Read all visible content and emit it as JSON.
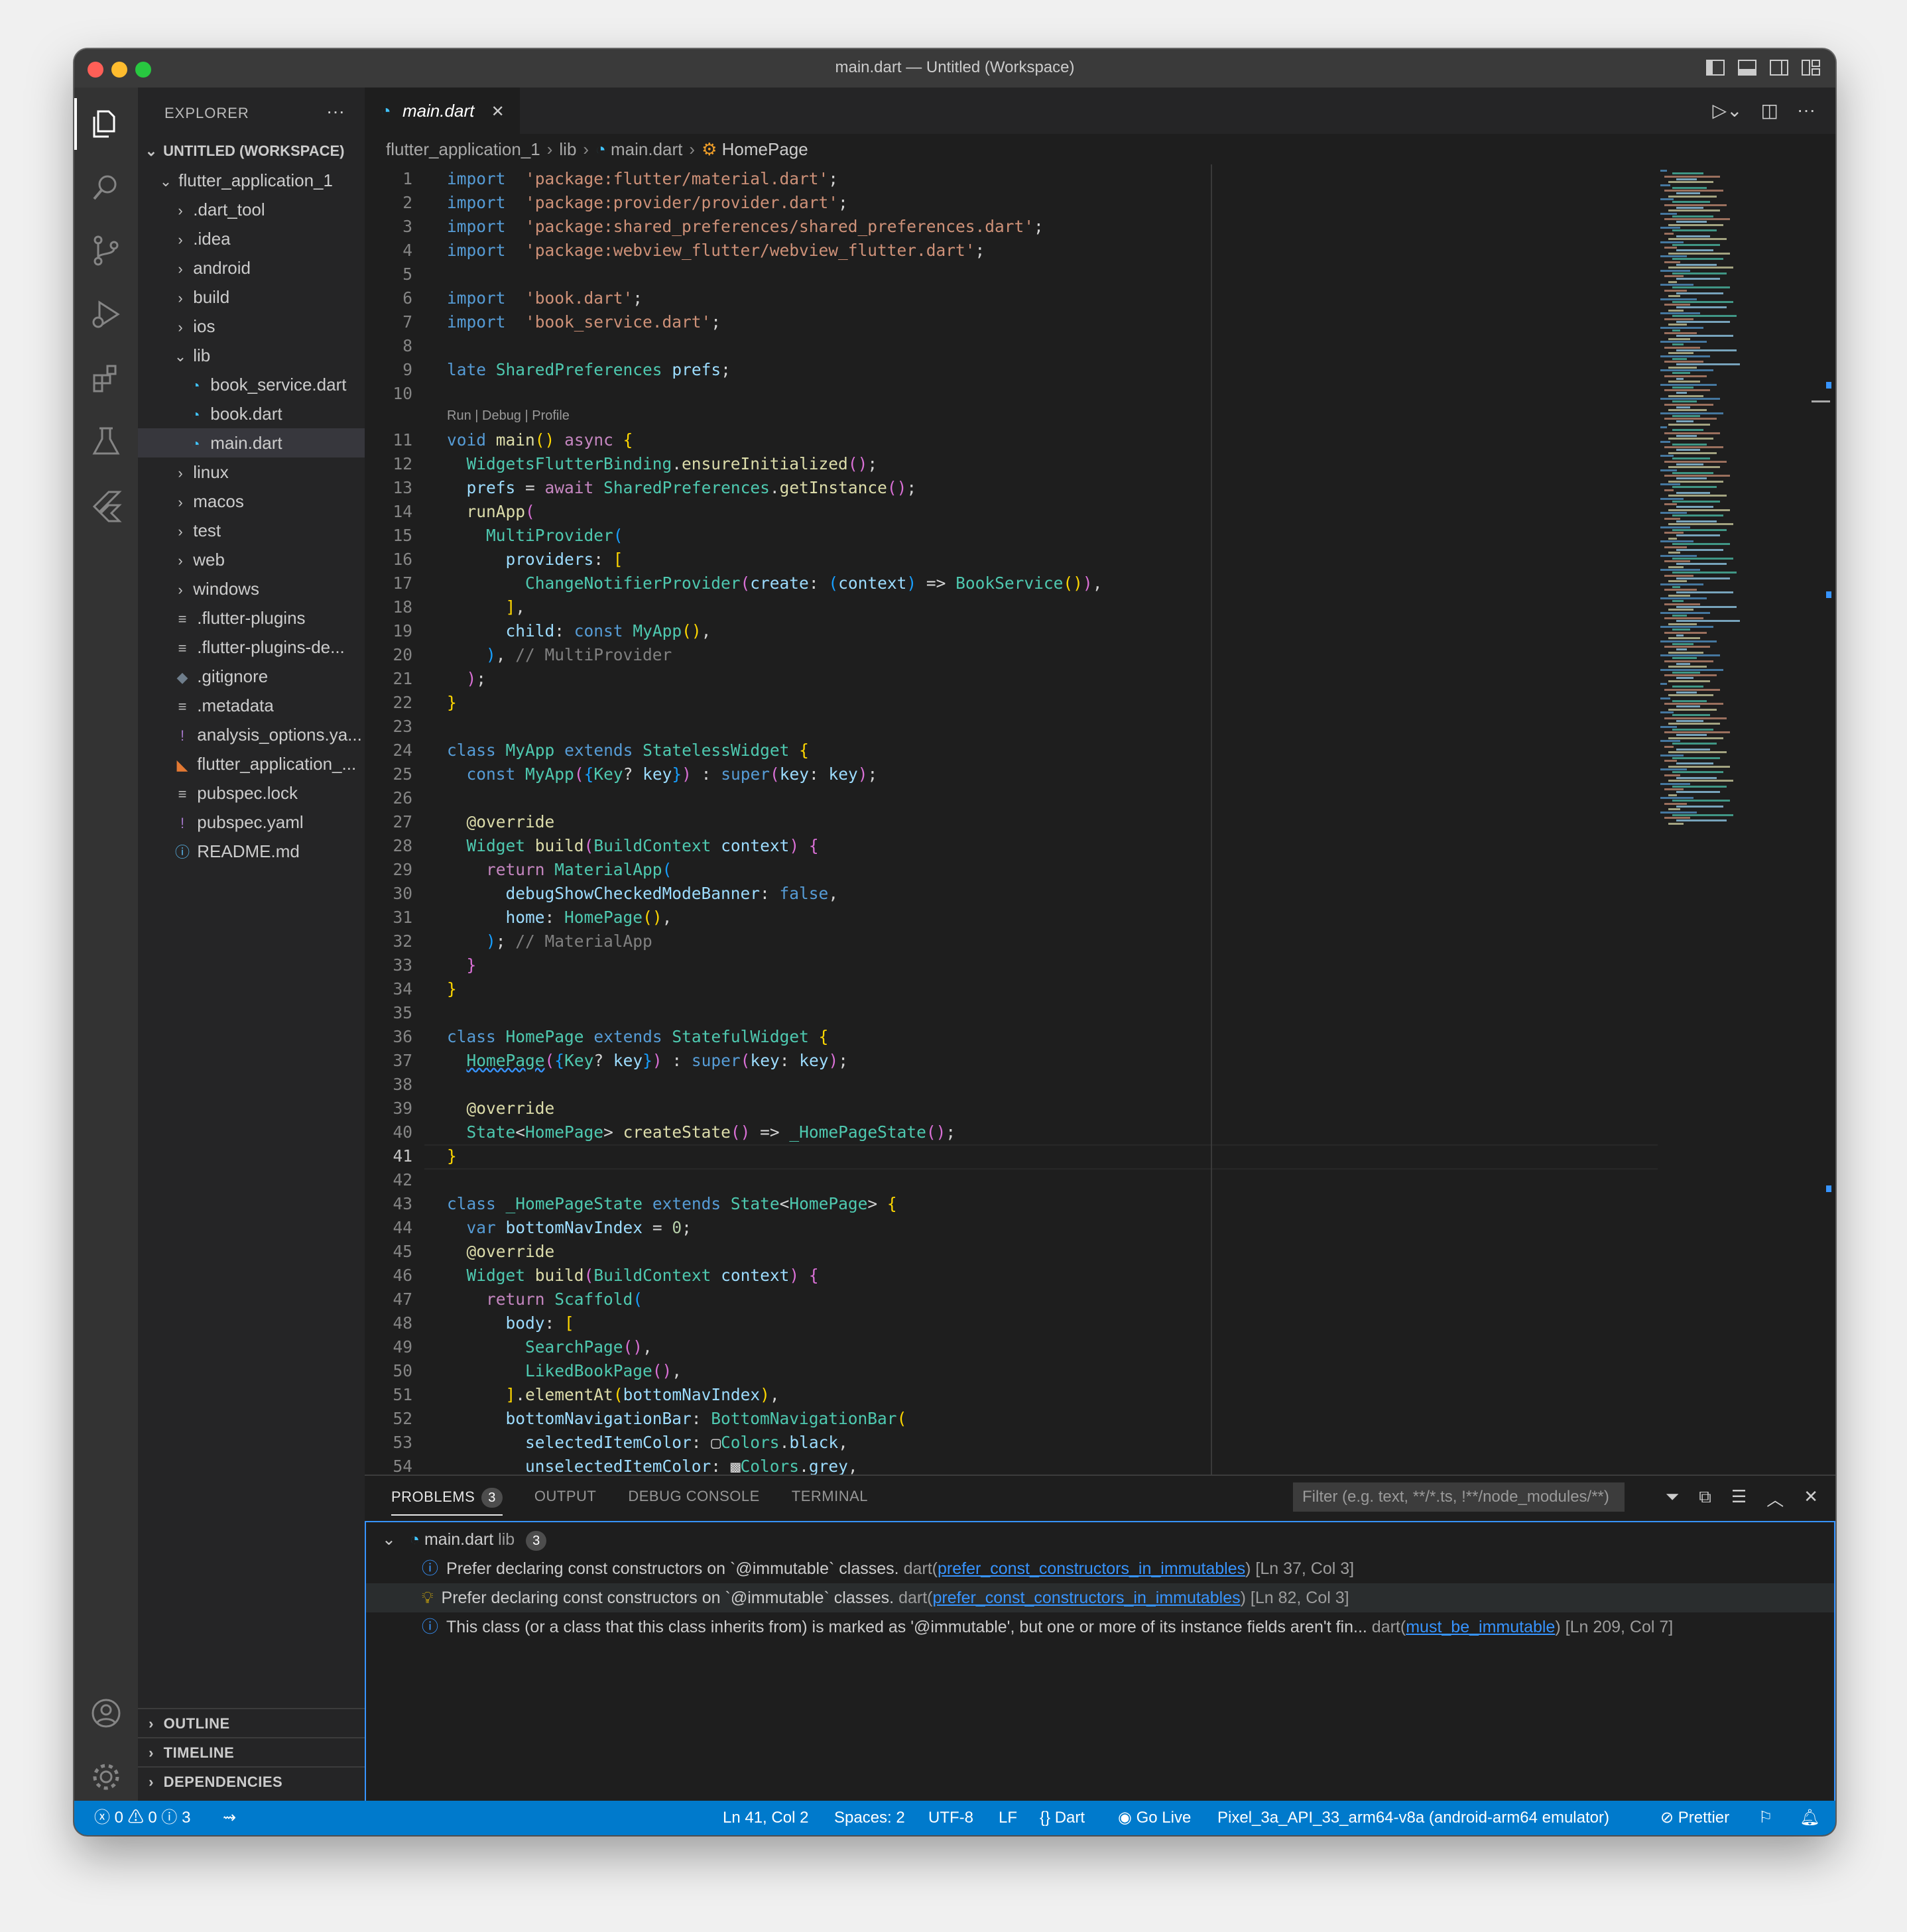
{
  "window": {
    "title": "main.dart — Untitled (Workspace)"
  },
  "explorer": {
    "header": "EXPLORER",
    "more": "···",
    "workspace": "UNTITLED (WORKSPACE)",
    "project": "flutter_application_1",
    "items": [
      {
        "label": ".dart_tool",
        "kind": "folder",
        "indent": 1
      },
      {
        "label": ".idea",
        "kind": "folder",
        "indent": 1
      },
      {
        "label": "android",
        "kind": "folder",
        "indent": 1
      },
      {
        "label": "build",
        "kind": "folder",
        "indent": 1
      },
      {
        "label": "ios",
        "kind": "folder",
        "indent": 1
      },
      {
        "label": "lib",
        "kind": "folder-open",
        "indent": 1
      },
      {
        "label": "book_service.dart",
        "kind": "dart",
        "indent": 2
      },
      {
        "label": "book.dart",
        "kind": "dart",
        "indent": 2
      },
      {
        "label": "main.dart",
        "kind": "dart",
        "indent": 2,
        "selected": true
      },
      {
        "label": "linux",
        "kind": "folder",
        "indent": 1
      },
      {
        "label": "macos",
        "kind": "folder",
        "indent": 1
      },
      {
        "label": "test",
        "kind": "folder",
        "indent": 1
      },
      {
        "label": "web",
        "kind": "folder",
        "indent": 1
      },
      {
        "label": "windows",
        "kind": "folder",
        "indent": 1
      },
      {
        "label": ".flutter-plugins",
        "kind": "lines",
        "indent": 1
      },
      {
        "label": ".flutter-plugins-de...",
        "kind": "lines",
        "indent": 1
      },
      {
        "label": ".gitignore",
        "kind": "git",
        "indent": 1
      },
      {
        "label": ".metadata",
        "kind": "lines",
        "indent": 1
      },
      {
        "label": "analysis_options.ya...",
        "kind": "yaml",
        "indent": 1
      },
      {
        "label": "flutter_application_...",
        "kind": "rss",
        "indent": 1
      },
      {
        "label": "pubspec.lock",
        "kind": "lines",
        "indent": 1
      },
      {
        "label": "pubspec.yaml",
        "kind": "yaml",
        "indent": 1
      },
      {
        "label": "README.md",
        "kind": "info",
        "indent": 1
      }
    ],
    "sections": [
      "OUTLINE",
      "TIMELINE",
      "DEPENDENCIES"
    ]
  },
  "tab": {
    "label": "main.dart",
    "close": "✕"
  },
  "breadcrumb": [
    "flutter_application_1",
    "lib",
    "main.dart",
    "HomePage"
  ],
  "codelens": "Run | Debug | Profile",
  "code": [
    [
      [
        "kw",
        "import"
      ],
      [
        "",
        "  "
      ],
      [
        "st",
        "'package:flutter/material.dart'"
      ],
      [
        "",
        ";"
      ]
    ],
    [
      [
        "kw",
        "import"
      ],
      [
        "",
        "  "
      ],
      [
        "st",
        "'package:provider/provider.dart'"
      ],
      [
        "",
        ";"
      ]
    ],
    [
      [
        "kw",
        "import"
      ],
      [
        "",
        "  "
      ],
      [
        "st",
        "'package:shared_preferences/shared_preferences.dart'"
      ],
      [
        "",
        ";"
      ]
    ],
    [
      [
        "kw",
        "import"
      ],
      [
        "",
        "  "
      ],
      [
        "st",
        "'package:webview_flutter/webview_flutter.dart'"
      ],
      [
        "",
        ";"
      ]
    ],
    [],
    [
      [
        "kw",
        "import"
      ],
      [
        "",
        "  "
      ],
      [
        "st",
        "'book.dart'"
      ],
      [
        "",
        ";"
      ]
    ],
    [
      [
        "kw",
        "import"
      ],
      [
        "",
        "  "
      ],
      [
        "st",
        "'book_service.dart'"
      ],
      [
        "",
        ";"
      ]
    ],
    [],
    [
      [
        "kw",
        "late"
      ],
      [
        "",
        " "
      ],
      [
        "ty",
        "SharedPreferences"
      ],
      [
        "",
        " "
      ],
      [
        "va",
        "prefs"
      ],
      [
        "",
        ";"
      ]
    ],
    [],
    [
      [
        "kw",
        "void"
      ],
      [
        "",
        " "
      ],
      [
        "fn",
        "main"
      ],
      [
        "br",
        "()"
      ],
      [
        "",
        " "
      ],
      [
        "kw2",
        "async"
      ],
      [
        "",
        " "
      ],
      [
        "br",
        "{"
      ]
    ],
    [
      [
        "",
        "  "
      ],
      [
        "ty",
        "WidgetsFlutterBinding"
      ],
      [
        "",
        "."
      ],
      [
        "fn",
        "ensureInitialized"
      ],
      [
        "br2",
        "()"
      ],
      [
        "",
        ";"
      ]
    ],
    [
      [
        "",
        "  "
      ],
      [
        "va",
        "prefs"
      ],
      [
        "",
        " = "
      ],
      [
        "kw2",
        "await"
      ],
      [
        "",
        " "
      ],
      [
        "ty",
        "SharedPreferences"
      ],
      [
        "",
        "."
      ],
      [
        "fn",
        "getInstance"
      ],
      [
        "br2",
        "()"
      ],
      [
        "",
        ";"
      ]
    ],
    [
      [
        "",
        "  "
      ],
      [
        "fn",
        "runApp"
      ],
      [
        "br2",
        "("
      ]
    ],
    [
      [
        "",
        "    "
      ],
      [
        "ty",
        "MultiProvider"
      ],
      [
        "br3",
        "("
      ]
    ],
    [
      [
        "",
        "      "
      ],
      [
        "va",
        "providers"
      ],
      [
        "",
        ": "
      ],
      [
        "br",
        "["
      ]
    ],
    [
      [
        "",
        "        "
      ],
      [
        "ty",
        "ChangeNotifierProvider"
      ],
      [
        "br2",
        "("
      ],
      [
        "va",
        "create"
      ],
      [
        "",
        ": "
      ],
      [
        "br3",
        "("
      ],
      [
        "va",
        "context"
      ],
      [
        "br3",
        ")"
      ],
      [
        "",
        " => "
      ],
      [
        "ty",
        "BookService"
      ],
      [
        "br",
        "()"
      ],
      [
        "br2",
        ")"
      ],
      [
        "",
        ","
      ]
    ],
    [
      [
        "",
        "      "
      ],
      [
        "br",
        "]"
      ],
      [
        "",
        ","
      ]
    ],
    [
      [
        "",
        "      "
      ],
      [
        "va",
        "child"
      ],
      [
        "",
        ": "
      ],
      [
        "kw",
        "const"
      ],
      [
        "",
        " "
      ],
      [
        "ty",
        "MyApp"
      ],
      [
        "br",
        "()"
      ],
      [
        "",
        ","
      ]
    ],
    [
      [
        "",
        "    "
      ],
      [
        "br3",
        ")"
      ],
      [
        "",
        ", "
      ],
      [
        "gr",
        "// MultiProvider"
      ]
    ],
    [
      [
        "",
        "  "
      ],
      [
        "br2",
        ")"
      ],
      [
        "",
        ";"
      ]
    ],
    [
      [
        "br",
        "}"
      ]
    ],
    [],
    [
      [
        "kw",
        "class"
      ],
      [
        "",
        " "
      ],
      [
        "ty",
        "MyApp"
      ],
      [
        "",
        " "
      ],
      [
        "kw",
        "extends"
      ],
      [
        "",
        " "
      ],
      [
        "ty",
        "StatelessWidget"
      ],
      [
        "",
        " "
      ],
      [
        "br",
        "{"
      ]
    ],
    [
      [
        "",
        "  "
      ],
      [
        "kw",
        "const"
      ],
      [
        "",
        " "
      ],
      [
        "ty",
        "MyApp"
      ],
      [
        "br2",
        "("
      ],
      [
        "br3",
        "{"
      ],
      [
        "ty",
        "Key"
      ],
      [
        "",
        "? "
      ],
      [
        "va",
        "key"
      ],
      [
        "br3",
        "}"
      ],
      [
        "br2",
        ")"
      ],
      [
        "",
        " : "
      ],
      [
        "kw",
        "super"
      ],
      [
        "br2",
        "("
      ],
      [
        "va",
        "key"
      ],
      [
        "",
        ": "
      ],
      [
        "va",
        "key"
      ],
      [
        "br2",
        ")"
      ],
      [
        "",
        ";"
      ]
    ],
    [],
    [
      [
        "",
        "  "
      ],
      [
        "an",
        "@override"
      ]
    ],
    [
      [
        "",
        "  "
      ],
      [
        "ty",
        "Widget"
      ],
      [
        "",
        " "
      ],
      [
        "fn",
        "build"
      ],
      [
        "br2",
        "("
      ],
      [
        "ty",
        "BuildContext"
      ],
      [
        "",
        " "
      ],
      [
        "va",
        "context"
      ],
      [
        "br2",
        ")"
      ],
      [
        "",
        " "
      ],
      [
        "br2",
        "{"
      ]
    ],
    [
      [
        "",
        "    "
      ],
      [
        "kw2",
        "return"
      ],
      [
        "",
        " "
      ],
      [
        "ty",
        "MaterialApp"
      ],
      [
        "br3",
        "("
      ]
    ],
    [
      [
        "",
        "      "
      ],
      [
        "va",
        "debugShowCheckedModeBanner"
      ],
      [
        "",
        ": "
      ],
      [
        "kw",
        "false"
      ],
      [
        "",
        ","
      ]
    ],
    [
      [
        "",
        "      "
      ],
      [
        "va",
        "home"
      ],
      [
        "",
        ": "
      ],
      [
        "ty",
        "HomePage"
      ],
      [
        "br",
        "()"
      ],
      [
        "",
        ","
      ]
    ],
    [
      [
        "",
        "    "
      ],
      [
        "br3",
        ")"
      ],
      [
        "",
        "; "
      ],
      [
        "gr",
        "// MaterialApp"
      ]
    ],
    [
      [
        "",
        "  "
      ],
      [
        "br2",
        "}"
      ]
    ],
    [
      [
        "br",
        "}"
      ]
    ],
    [],
    [
      [
        "kw",
        "class"
      ],
      [
        "",
        " "
      ],
      [
        "ty",
        "HomePage"
      ],
      [
        "",
        " "
      ],
      [
        "kw",
        "extends"
      ],
      [
        "",
        " "
      ],
      [
        "ty",
        "StatefulWidget"
      ],
      [
        "",
        " "
      ],
      [
        "br",
        "{"
      ]
    ],
    [
      [
        "",
        "  "
      ],
      [
        "ty",
        "HomePage"
      ],
      [
        "br2",
        "("
      ],
      [
        "br3",
        "{"
      ],
      [
        "ty",
        "Key"
      ],
      [
        "",
        "? "
      ],
      [
        "va",
        "key"
      ],
      [
        "br3",
        "}"
      ],
      [
        "br2",
        ")"
      ],
      [
        "",
        " : "
      ],
      [
        "kw",
        "super"
      ],
      [
        "br2",
        "("
      ],
      [
        "va",
        "key"
      ],
      [
        "",
        ": "
      ],
      [
        "va",
        "key"
      ],
      [
        "br2",
        ")"
      ],
      [
        "",
        ";"
      ]
    ],
    [],
    [
      [
        "",
        "  "
      ],
      [
        "an",
        "@override"
      ]
    ],
    [
      [
        "",
        "  "
      ],
      [
        "ty",
        "State"
      ],
      [
        "",
        "<"
      ],
      [
        "ty",
        "HomePage"
      ],
      [
        "",
        "> "
      ],
      [
        "fn",
        "createState"
      ],
      [
        "br2",
        "()"
      ],
      [
        "",
        " => "
      ],
      [
        "ty",
        "_HomePageState"
      ],
      [
        "br2",
        "()"
      ],
      [
        "",
        ";"
      ]
    ],
    [
      [
        "br",
        "}"
      ]
    ],
    [],
    [
      [
        "kw",
        "class"
      ],
      [
        "",
        " "
      ],
      [
        "ty",
        "_HomePageState"
      ],
      [
        "",
        " "
      ],
      [
        "kw",
        "extends"
      ],
      [
        "",
        " "
      ],
      [
        "ty",
        "State"
      ],
      [
        "",
        "<"
      ],
      [
        "ty",
        "HomePage"
      ],
      [
        "",
        "> "
      ],
      [
        "br",
        "{"
      ]
    ],
    [
      [
        "",
        "  "
      ],
      [
        "kw",
        "var"
      ],
      [
        "",
        " "
      ],
      [
        "va",
        "bottomNavIndex"
      ],
      [
        "",
        " = "
      ],
      [
        "nu",
        "0"
      ],
      [
        "",
        ";"
      ]
    ],
    [
      [
        "",
        "  "
      ],
      [
        "an",
        "@override"
      ]
    ],
    [
      [
        "",
        "  "
      ],
      [
        "ty",
        "Widget"
      ],
      [
        "",
        " "
      ],
      [
        "fn",
        "build"
      ],
      [
        "br2",
        "("
      ],
      [
        "ty",
        "BuildContext"
      ],
      [
        "",
        " "
      ],
      [
        "va",
        "context"
      ],
      [
        "br2",
        ")"
      ],
      [
        "",
        " "
      ],
      [
        "br2",
        "{"
      ]
    ],
    [
      [
        "",
        "    "
      ],
      [
        "kw2",
        "return"
      ],
      [
        "",
        " "
      ],
      [
        "ty",
        "Scaffold"
      ],
      [
        "br3",
        "("
      ]
    ],
    [
      [
        "",
        "      "
      ],
      [
        "va",
        "body"
      ],
      [
        "",
        ": "
      ],
      [
        "br",
        "["
      ]
    ],
    [
      [
        "",
        "        "
      ],
      [
        "ty",
        "SearchPage"
      ],
      [
        "br2",
        "()"
      ],
      [
        "",
        ","
      ]
    ],
    [
      [
        "",
        "        "
      ],
      [
        "ty",
        "LikedBookPage"
      ],
      [
        "br2",
        "()"
      ],
      [
        "",
        ","
      ]
    ],
    [
      [
        "",
        "      "
      ],
      [
        "br",
        "]"
      ],
      [
        "",
        "."
      ],
      [
        "fn",
        "elementAt"
      ],
      [
        "br",
        "("
      ],
      [
        "va",
        "bottomNavIndex"
      ],
      [
        "br",
        ")"
      ],
      [
        "",
        ","
      ]
    ],
    [
      [
        "",
        "      "
      ],
      [
        "va",
        "bottomNavigationBar"
      ],
      [
        "",
        ": "
      ],
      [
        "ty",
        "BottomNavigationBar"
      ],
      [
        "br",
        "("
      ]
    ],
    [
      [
        "",
        "        "
      ],
      [
        "va",
        "selectedItemColor"
      ],
      [
        "",
        ": ▢"
      ],
      [
        "ty",
        "Colors"
      ],
      [
        "",
        "."
      ],
      [
        "va",
        "black"
      ],
      [
        "",
        ","
      ]
    ],
    [
      [
        "",
        "        "
      ],
      [
        "va",
        "unselectedItemColor"
      ],
      [
        "",
        ": ▩"
      ],
      [
        "ty",
        "Colors"
      ],
      [
        "",
        "."
      ],
      [
        "va",
        "grey"
      ],
      [
        "",
        ","
      ]
    ]
  ],
  "cursor_line": 41,
  "panel": {
    "tabs": [
      {
        "label": "PROBLEMS",
        "badge": "3",
        "active": true
      },
      {
        "label": "OUTPUT"
      },
      {
        "label": "DEBUG CONSOLE"
      },
      {
        "label": "TERMINAL"
      }
    ],
    "filter_placeholder": "Filter (e.g. text, **/*.ts, !**/node_modules/**)",
    "file_group": {
      "name": "main.dart",
      "path": "lib",
      "count": "3"
    },
    "problems": [
      {
        "icon": "info",
        "message": "Prefer declaring const constructors on `@immutable` classes.",
        "source": "dart",
        "code": "prefer_const_constructors_in_immutables",
        "location": "[Ln 37, Col 3]"
      },
      {
        "icon": "bulb",
        "message": "Prefer declaring const constructors on `@immutable` classes.",
        "source": "dart",
        "code": "prefer_const_constructors_in_immutables",
        "location": "[Ln 82, Col 3]"
      },
      {
        "icon": "info",
        "message": "This class (or a class that this class inherits from) is marked as '@immutable', but one or more of its instance fields aren't fin...",
        "source": "dart",
        "code": "must_be_immutable",
        "location": "[Ln 209, Col 7]"
      }
    ]
  },
  "status": {
    "errors": "0",
    "warnings": "0",
    "infos": "3",
    "position": "Ln 41, Col 2",
    "spaces": "Spaces: 2",
    "encoding": "UTF-8",
    "eol": "LF",
    "language": "Dart",
    "golive": "Go Live",
    "device": "Pixel_3a_API_33_arm64-v8a (android-arm64 emulator)",
    "prettier": "Prettier"
  },
  "colors": {
    "accent": "#007acc",
    "statusbar": "#007acc",
    "link": "#3794ff"
  }
}
